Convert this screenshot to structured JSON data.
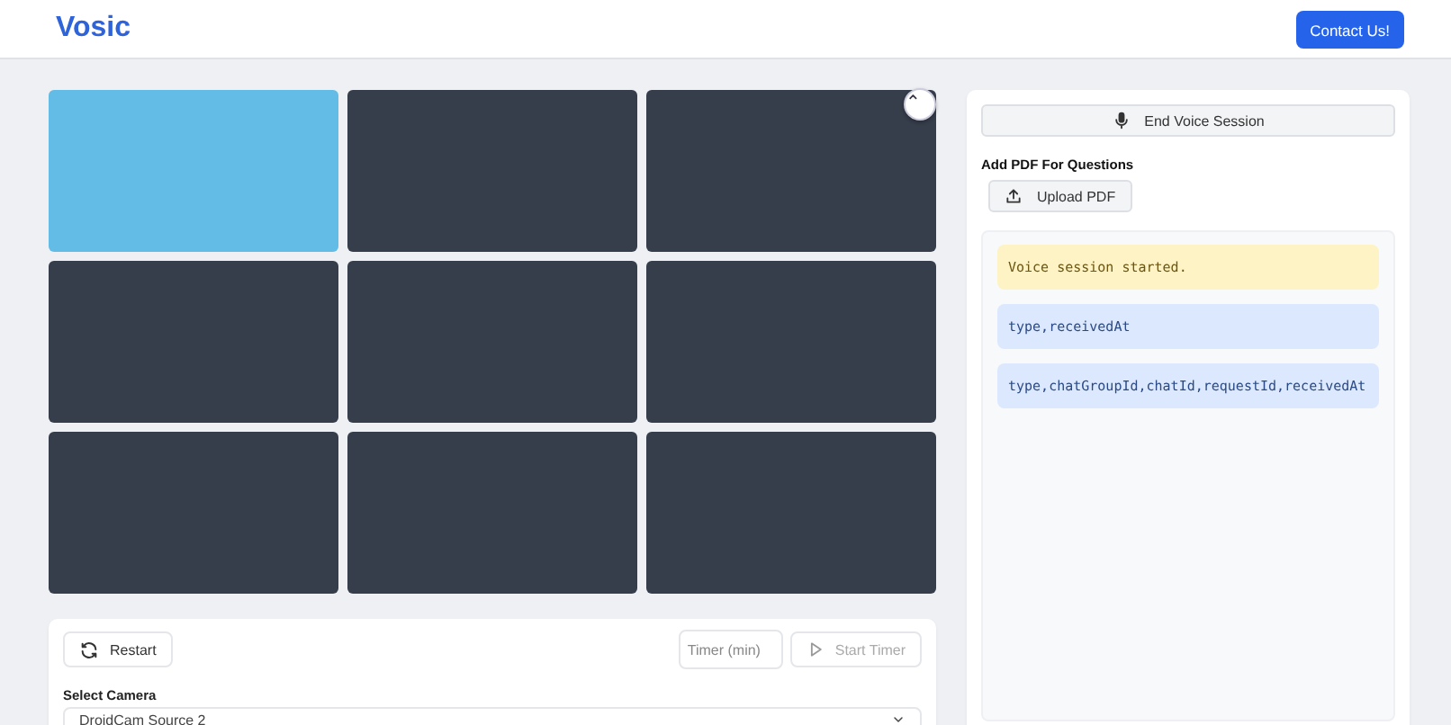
{
  "header": {
    "logo": "Vosic",
    "contact_button": "Contact Us!"
  },
  "video_grid": {
    "collapse_button": "⌃",
    "tiles": [
      {
        "color": "#63bce5"
      },
      {
        "color": "#363d4b"
      },
      {
        "color": "#363d4b"
      },
      {
        "color": "#363d4b"
      },
      {
        "color": "#363d4b"
      },
      {
        "color": "#363d4b"
      },
      {
        "color": "#363d4b"
      },
      {
        "color": "#363d4b"
      },
      {
        "color": "#363d4b"
      }
    ]
  },
  "controls": {
    "restart_button": "Restart",
    "timer_field": {
      "placeholder": "Timer (min)"
    },
    "start_timer_button": {
      "label": "Start Timer",
      "disabled": true
    },
    "camera_label": "Select Camera",
    "camera_select": "DroidCam Source 2"
  },
  "side_panel": {
    "voice_button": "End Voice Session",
    "pdf_heading": "Add PDF For Questions",
    "upload_button": "Upload PDF",
    "messages": [
      {
        "kind": "status",
        "text": "Voice session started."
      },
      {
        "kind": "data",
        "text": "type,receivedAt"
      },
      {
        "kind": "data",
        "text": "type,chatGroupId,chatId,requestId,receivedAt"
      }
    ]
  }
}
